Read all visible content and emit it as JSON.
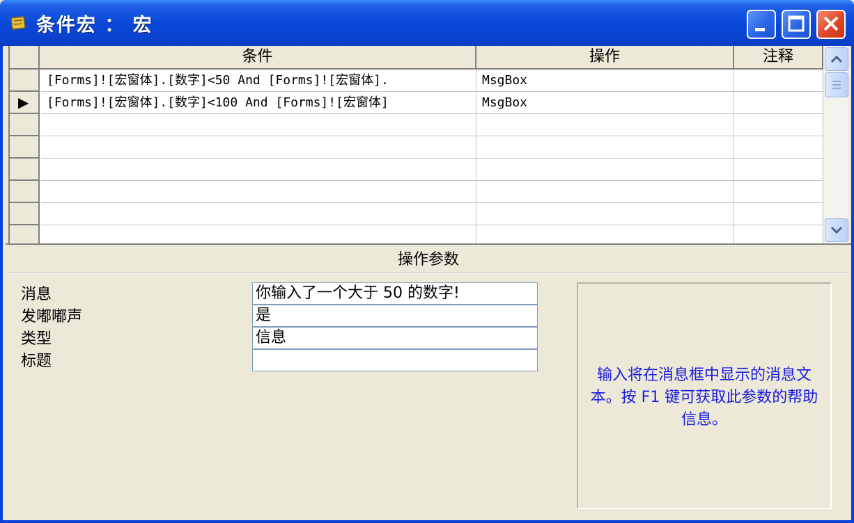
{
  "window": {
    "title": "条件宏 ： 宏",
    "buttons": {
      "minimize": "minimize-icon",
      "maximize": "maximize-icon",
      "close": "close-icon"
    }
  },
  "grid": {
    "columns": [
      "条件",
      "操作",
      "注释"
    ],
    "rows": [
      {
        "condition": "[Forms]![宏窗体].[数字]<50 And [Forms]![宏窗体].",
        "action": "MsgBox",
        "comment": ""
      },
      {
        "condition": "[Forms]![宏窗体].[数字]<100 And [Forms]![宏窗体]",
        "action": "MsgBox",
        "comment": ""
      }
    ],
    "current_row_marker": "▶"
  },
  "params": {
    "title": "操作参数",
    "fields": [
      {
        "label": "消息",
        "value": "你输入了一个大于 50 的数字!"
      },
      {
        "label": "发嘟嘟声",
        "value": "是"
      },
      {
        "label": "类型",
        "value": "信息"
      },
      {
        "label": "标题",
        "value": ""
      }
    ],
    "help": "输入将在消息框中显示的消息文本。按 F1 键可获取此参数的帮助信息。"
  },
  "colors": {
    "titlebar": "#0a48d8",
    "help_text": "#1a1adf",
    "face": "#ece9d8"
  }
}
